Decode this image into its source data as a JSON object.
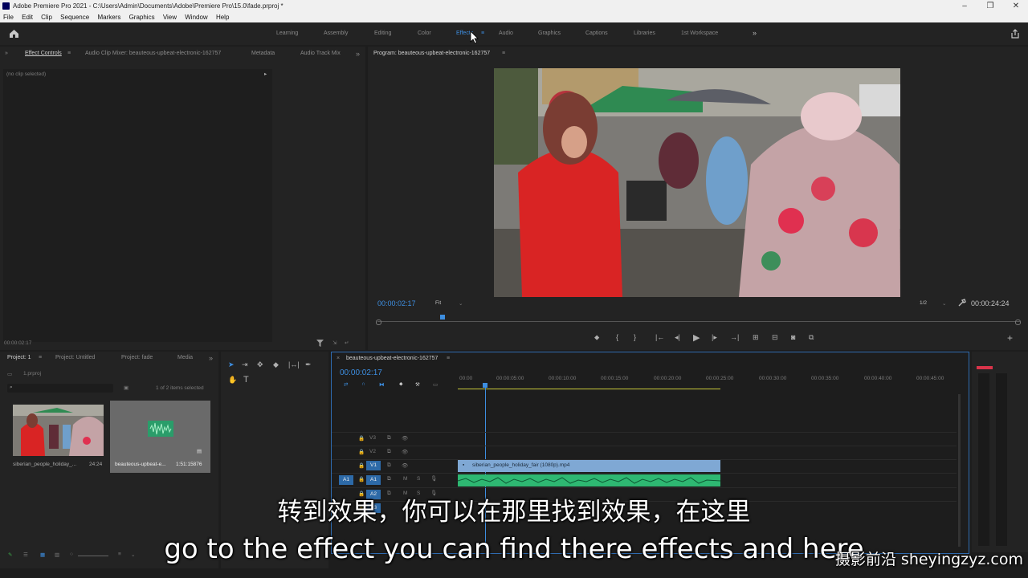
{
  "window": {
    "title": "Adobe Premiere Pro 2021 - C:\\Users\\Admin\\Documents\\Adobe\\Premiere Pro\\15.0\\fade.prproj *"
  },
  "menu": [
    "File",
    "Edit",
    "Clip",
    "Sequence",
    "Markers",
    "Graphics",
    "View",
    "Window",
    "Help"
  ],
  "workspaces": [
    {
      "label": "Learning",
      "active": false
    },
    {
      "label": "Assembly",
      "active": false
    },
    {
      "label": "Editing",
      "active": false
    },
    {
      "label": "Color",
      "active": false
    },
    {
      "label": "Effects",
      "active": true
    },
    {
      "label": "Audio",
      "active": false
    },
    {
      "label": "Graphics",
      "active": false
    },
    {
      "label": "Captions",
      "active": false
    },
    {
      "label": "Libraries",
      "active": false
    },
    {
      "label": "1st Workspace",
      "active": false
    }
  ],
  "source_panel": {
    "tabs": [
      "Effect Controls",
      "Audio Clip Mixer: beauteous-upbeat-electronic-162757",
      "Metadata",
      "Audio Track Mix"
    ],
    "no_clip": "(no clip selected)",
    "timecode": "00:00:02:17"
  },
  "program": {
    "title": "Program: beauteous-upbeat-electronic-162757",
    "timecode": "00:00:02:17",
    "fit": "Fit",
    "resolution": "1/2",
    "duration": "00:00:24:24"
  },
  "project": {
    "tabs": [
      "Project: 1",
      "Project: Untitled",
      "Project: fade",
      "Media"
    ],
    "file": "1.prproj",
    "selection": "1 of 2 items selected",
    "items": [
      {
        "name": "siberian_people_holiday_...",
        "duration": "24:24"
      },
      {
        "name": "beauteous-upbeat-e...",
        "duration": "1:51:15876"
      }
    ]
  },
  "timeline": {
    "sequence": "beauteous-upbeat-electronic-162757",
    "timecode": "00:00:02:17",
    "ruler": [
      "00:00",
      "00:00:05:00",
      "00:00:10:00",
      "00:00:15:00",
      "00:00:20:00",
      "00:00:25:00",
      "00:00:30:00",
      "00:00:35:00",
      "00:00:40:00",
      "00:00:45:00"
    ],
    "video_tracks": [
      "V3",
      "V2",
      "V1"
    ],
    "audio_tracks": [
      "A1",
      "A2",
      "A3"
    ],
    "source_patch": "A1",
    "video_clip": "siberian_people_holiday_fair (1080p).mp4",
    "m": "M",
    "s": "S"
  },
  "subtitles": {
    "chinese": "转到效果，你可以在那里找到效果，在这里",
    "english": "go to the effect you can find there effects and here"
  },
  "watermark": "摄影前沿 sheyingzyz.com",
  "colors": {
    "accent": "#3d8ee0",
    "audio_clip": "#2eb872",
    "video_clip": "#7fa8d4"
  }
}
